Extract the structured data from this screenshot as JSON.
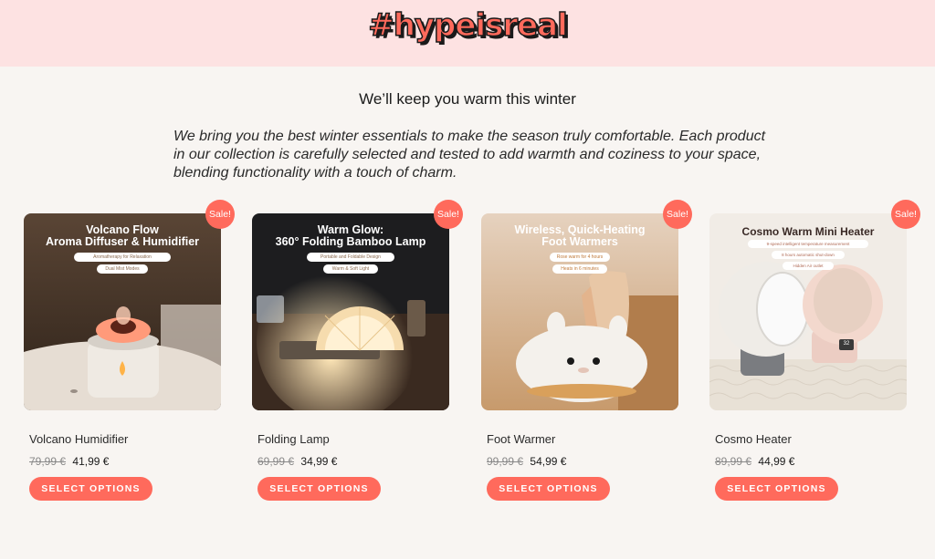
{
  "header": {
    "logo_text": "#hypeisreal",
    "colors": {
      "background": "#fde2e2",
      "logo_fill": "#ff6a5c",
      "logo_outline": "#1a1a1a"
    }
  },
  "intro": {
    "title": "We’ll keep you warm this winter",
    "text": "We bring you the best winter essentials to make the season truly comfortable. Each product in our collection is carefully selected and tested to add warmth and coziness to your space, blending functionality with a touch of charm."
  },
  "colors": {
    "accent": "#ff6a5c",
    "page_background": "#f8f5f2"
  },
  "products": [
    {
      "name": "Volcano Humidifier",
      "old_price": "79,99 €",
      "price": "41,99 €",
      "badge": "Sale!",
      "button": "SELECT OPTIONS",
      "image": {
        "title_line1": "Volcano Flow",
        "title_line2": "Aroma Diffuser & Humidifier",
        "tag1": "Aromatherapy for Relaxation",
        "tag2": "Dual Mist Modes"
      }
    },
    {
      "name": "Folding Lamp",
      "old_price": "69,99 €",
      "price": "34,99 €",
      "badge": "Sale!",
      "button": "SELECT OPTIONS",
      "image": {
        "title_line1": "Warm Glow:",
        "title_line2": "360° Folding Bamboo Lamp",
        "tag1": "Portable and Foldable Design",
        "tag2": "Warm & Soft Light"
      }
    },
    {
      "name": "Foot Warmer",
      "old_price": "99,99 €",
      "price": "54,99 €",
      "badge": "Sale!",
      "button": "SELECT OPTIONS",
      "image": {
        "title_line1": "Wireless, Quick-Heating",
        "title_line2": "Foot Warmers",
        "tag1": "Rose warm for 4 hours",
        "tag2": "Heats in 6 minutes"
      }
    },
    {
      "name": "Cosmo Heater",
      "old_price": "89,99 €",
      "price": "44,99 €",
      "badge": "Sale!",
      "button": "SELECT OPTIONS",
      "image": {
        "title_line1": "Cosmo Warm Mini Heater",
        "tag1": "9-speed intelligent temperature measurement",
        "tag2": "8 hours automatic shut-down",
        "tag3": "Hidden Air outlet",
        "display": "32"
      }
    }
  ]
}
